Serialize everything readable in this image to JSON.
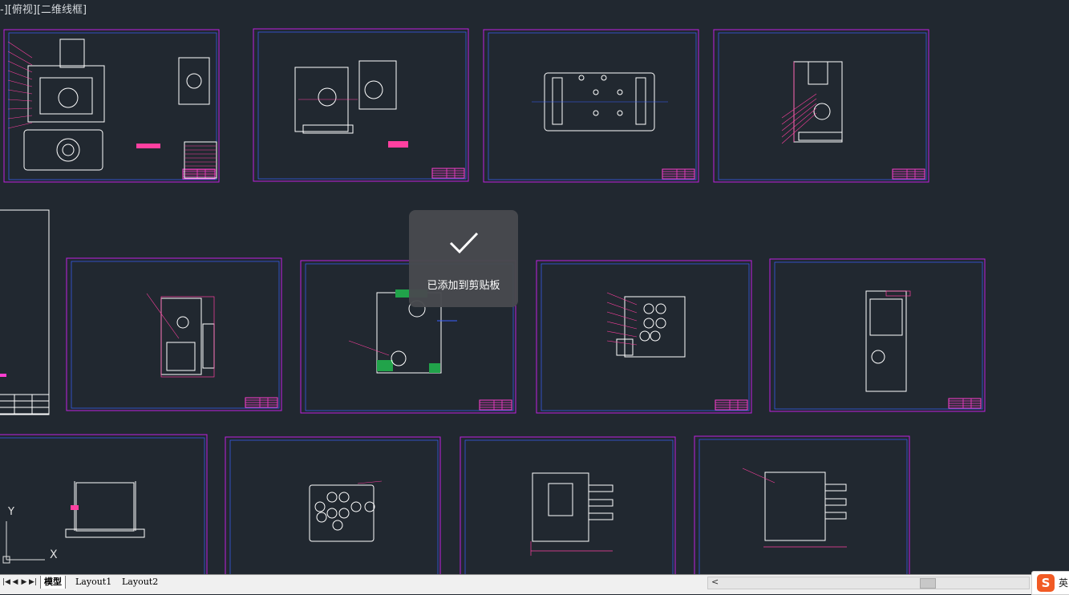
{
  "viewport": {
    "label": "-][俯视][二维线框]"
  },
  "toast": {
    "message": "已添加到剪贴板",
    "icon": "checkmark-icon"
  },
  "ucs": {
    "y_label": "Y",
    "x_label": "X"
  },
  "tabs": {
    "nav_icons": [
      "first-page-icon",
      "prev-page-icon",
      "next-page-icon",
      "last-page-icon"
    ],
    "items": [
      "模型",
      "Layout1",
      "Layout2"
    ],
    "active": "模型"
  },
  "scrollbar": {
    "arrow": "<"
  },
  "ime": {
    "logo": "S",
    "text": "英"
  },
  "colors": {
    "background": "#212830",
    "sheet_border": "#c020e0",
    "title_block": "#ff3ed0",
    "geometry": "#ffffff",
    "dimension": "#ff40a0",
    "highlight": "#21a34a",
    "accent": "#3a60ff"
  }
}
